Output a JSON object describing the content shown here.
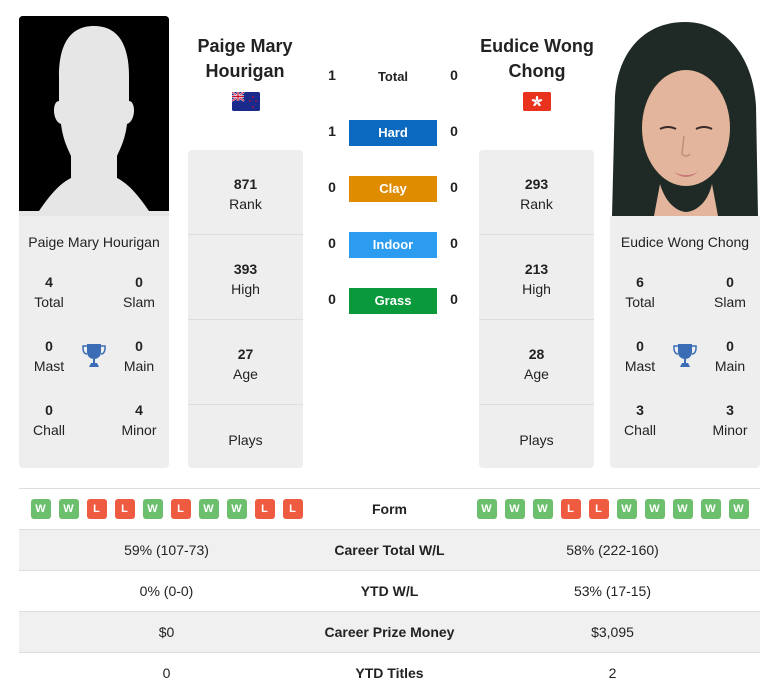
{
  "player1": {
    "name": "Paige Mary Hourigan",
    "name_line1": "Paige Mary",
    "name_line2": "Hourigan",
    "flag": "new-zealand-flag",
    "rank": "871",
    "rank_label": "Rank",
    "high": "393",
    "high_label": "High",
    "age": "27",
    "age_label": "Age",
    "plays_label": "Plays",
    "titles": {
      "total": "4",
      "total_label": "Total",
      "slam": "0",
      "slam_label": "Slam",
      "mast": "0",
      "mast_label": "Mast",
      "main": "0",
      "main_label": "Main",
      "chall": "0",
      "chall_label": "Chall",
      "minor": "4",
      "minor_label": "Minor"
    },
    "form": [
      "W",
      "W",
      "L",
      "L",
      "W",
      "L",
      "W",
      "W",
      "L",
      "L"
    ],
    "career_wl": "59% (107-73)",
    "ytd_wl": "0% (0-0)",
    "prize": "$0",
    "ytd_titles": "0"
  },
  "player2": {
    "name": "Eudice Wong Chong",
    "name_line1": "Eudice Wong",
    "name_line2": "Chong",
    "flag": "hong-kong-flag",
    "rank": "293",
    "rank_label": "Rank",
    "high": "213",
    "high_label": "High",
    "age": "28",
    "age_label": "Age",
    "plays_label": "Plays",
    "titles": {
      "total": "6",
      "total_label": "Total",
      "slam": "0",
      "slam_label": "Slam",
      "mast": "0",
      "mast_label": "Mast",
      "main": "0",
      "main_label": "Main",
      "chall": "3",
      "chall_label": "Chall",
      "minor": "3",
      "minor_label": "Minor"
    },
    "form": [
      "W",
      "W",
      "W",
      "L",
      "L",
      "W",
      "W",
      "W",
      "W",
      "W"
    ],
    "career_wl": "58% (222-160)",
    "ytd_wl": "53% (17-15)",
    "prize": "$3,095",
    "ytd_titles": "2"
  },
  "h2h": {
    "total": {
      "label": "Total",
      "p1": "1",
      "p2": "0"
    },
    "surfaces": [
      {
        "label": "Hard",
        "p1": "1",
        "p2": "0",
        "color": "#0b6abf"
      },
      {
        "label": "Clay",
        "p1": "0",
        "p2": "0",
        "color": "#e08c00"
      },
      {
        "label": "Indoor",
        "p1": "0",
        "p2": "0",
        "color": "#2b9cf0"
      },
      {
        "label": "Grass",
        "p1": "0",
        "p2": "0",
        "color": "#0a9a3c"
      }
    ]
  },
  "table_labels": {
    "form": "Form",
    "career_wl": "Career Total W/L",
    "ytd_wl": "YTD W/L",
    "prize": "Career Prize Money",
    "ytd_titles": "YTD Titles"
  }
}
